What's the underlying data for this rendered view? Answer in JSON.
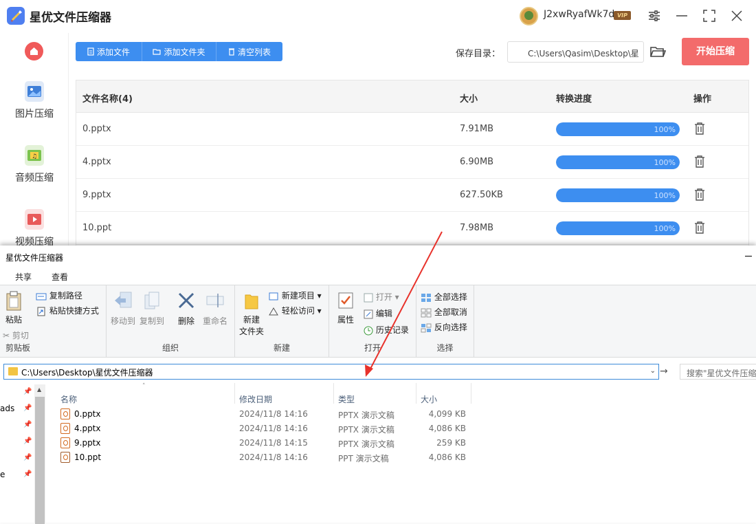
{
  "app": {
    "title": "星优文件压缩器",
    "username": "J2xwRyafWk7d",
    "vip": "VIP"
  },
  "sidebar": {
    "items": [
      {
        "label": "图片压缩",
        "icon": "image-icon"
      },
      {
        "label": "音频压缩",
        "icon": "music-icon"
      },
      {
        "label": "视频压缩",
        "icon": "video-icon"
      }
    ]
  },
  "toolbar": {
    "add_file": "添加文件",
    "add_folder": "添加文件夹",
    "clear_list": "清空列表",
    "save_label": "保存目录：",
    "save_path": "C:\\Users\\Qasim\\Desktop\\星",
    "start": "开始压缩"
  },
  "table": {
    "headers": {
      "name": "文件名称(4)",
      "size": "大小",
      "progress": "转换进度",
      "action": "操作"
    },
    "rows": [
      {
        "name": "0.pptx",
        "size": "7.91MB",
        "progress": 1.0,
        "progress_text": "100%"
      },
      {
        "name": "4.pptx",
        "size": "6.90MB",
        "progress": 1.0,
        "progress_text": "100%"
      },
      {
        "name": "9.pptx",
        "size": "627.50KB",
        "progress": 1.0,
        "progress_text": "100%"
      },
      {
        "name": "10.ppt",
        "size": "7.98MB",
        "progress": 1.0,
        "progress_text": "100%"
      }
    ]
  },
  "explorer": {
    "title": "星优文件压缩器",
    "tabs": [
      "共享",
      "查看"
    ],
    "ribbon": {
      "paste": "粘贴",
      "copy_path": "复制路径",
      "paste_shortcut": "粘贴快捷方式",
      "cut": "剪切",
      "clipboard_group": "剪贴板",
      "move_to": "移动到",
      "copy_to": "复制到",
      "delete": "删除",
      "rename": "重命名",
      "organize_group": "组织",
      "new_folder_1": "新建",
      "new_folder_2": "文件夹",
      "new_item": "新建项目",
      "easy_access": "轻松访问",
      "new_group": "新建",
      "properties": "属性",
      "open": "打开",
      "edit": "编辑",
      "history": "历史记录",
      "open_group": "打开",
      "select_all": "全部选择",
      "select_none": "全部取消",
      "invert_selection": "反向选择",
      "select_group": "选择"
    },
    "address": "C:\\Users\\Desktop\\星优文件压缩器",
    "search_placeholder": "搜索\"星优文件压缩器",
    "nav": [
      "ads",
      "e"
    ],
    "columns": {
      "name": "名称",
      "date": "修改日期",
      "type": "类型",
      "size": "大小"
    },
    "files": [
      {
        "name": "0.pptx",
        "date": "2024/11/8 14:16",
        "type": "PPTX 演示文稿",
        "size": "4,099 KB"
      },
      {
        "name": "4.pptx",
        "date": "2024/11/8 14:16",
        "type": "PPTX 演示文稿",
        "size": "4,086 KB"
      },
      {
        "name": "9.pptx",
        "date": "2024/11/8 14:15",
        "type": "PPTX 演示文稿",
        "size": "259 KB"
      },
      {
        "name": "10.ppt",
        "date": "2024/11/8 14:16",
        "type": "PPT 演示文稿",
        "size": "4,086 KB"
      }
    ]
  },
  "colors": {
    "accent": "#3d8ef0",
    "start_button": "#f36b6b",
    "arrow": "#e8322b"
  }
}
